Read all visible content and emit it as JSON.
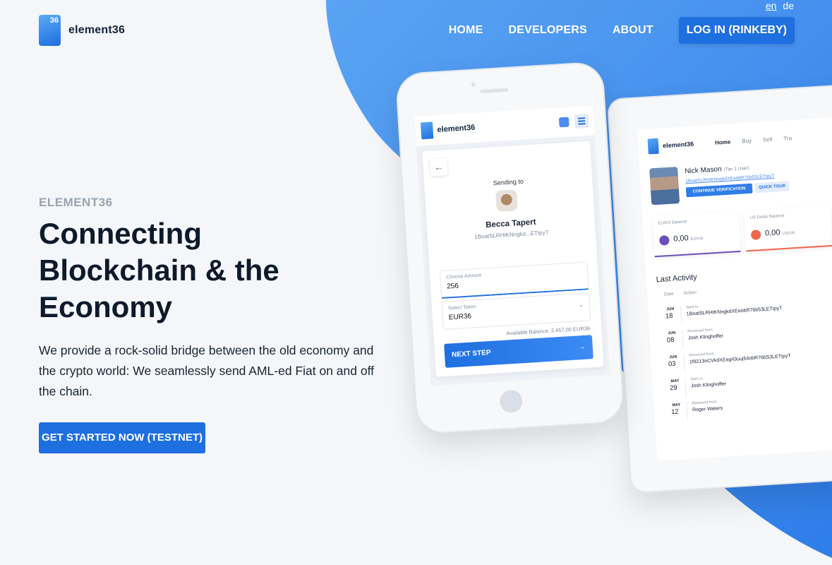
{
  "colors": {
    "primary": "#1e6fe0",
    "blob": "#3f8cec",
    "background": "#f4f6f9"
  },
  "header": {
    "logo_badge": "36",
    "brand": "element36",
    "languages": [
      {
        "code": "en",
        "active": true
      },
      {
        "code": "de",
        "active": false
      }
    ],
    "nav": [
      "HOME",
      "DEVELOPERS",
      "ABOUT"
    ],
    "login_label": "LOG IN (RINKEBY)"
  },
  "hero": {
    "eyebrow": "ELEMENT36",
    "headline": "Connecting Blockchain & the Economy",
    "lead": "We provide a rock-solid bridge between the old economy and the crypto world: We seamlessly send AML-ed Fiat on and off the chain.",
    "cta_label": "GET STARTED NOW (TESTNET)"
  },
  "phone": {
    "brand": "element36",
    "back_icon": "arrow-left-icon",
    "sending_to": "Sending to",
    "recipient_name": "Becca Tapert",
    "recipient_address": "1BoatSLRHtKNngkd...ETtpyT",
    "amount_label": "Choose Amount",
    "amount_value": "256",
    "token_label": "Select Token",
    "token_value": "EUR36",
    "balance": "Available Balance: 3,457,00 EUR36",
    "next_label": "NEXT STEP"
  },
  "tablet": {
    "brand": "element36",
    "nav": [
      "Home",
      "Buy",
      "Sell",
      "Tra"
    ],
    "user_name": "Nick Mason",
    "user_tier": "(Tier 1 User)",
    "user_address": "1BoatSLRHtKNngkdXEeobR76b53LETtpyT",
    "verify_label": "CONTINUE VERIFICATION",
    "tour_label": "QUICK TOUR",
    "balances": [
      {
        "label": "EURO Balance",
        "value": "0,00",
        "unit": "EUR36",
        "color": "#6b4fbb"
      },
      {
        "label": "US Dollar Balance",
        "value": "0,00",
        "unit": "USD36",
        "color": "#f0674a"
      }
    ],
    "last_activity_title": "Last Activity",
    "columns": [
      "Date",
      "Action"
    ],
    "activity": [
      {
        "month": "JUN",
        "day": "18",
        "kind": "Sent to",
        "who": "1BoatSLRHtKNngkdXEeobR76b53LETtpyT"
      },
      {
        "month": "JUN",
        "day": "08",
        "kind": "Received from",
        "who": "Josh Klinghoffer"
      },
      {
        "month": "JUN",
        "day": "03",
        "kind": "Received from",
        "who": "1f9213nCVkdXEeg43uuj54obR76bS3LETtpyT"
      },
      {
        "month": "MAY",
        "day": "29",
        "kind": "Sent to",
        "who": "Josh Klinghoffer"
      },
      {
        "month": "MAY",
        "day": "12",
        "kind": "Received from",
        "who": "Roger Waters"
      }
    ]
  }
}
